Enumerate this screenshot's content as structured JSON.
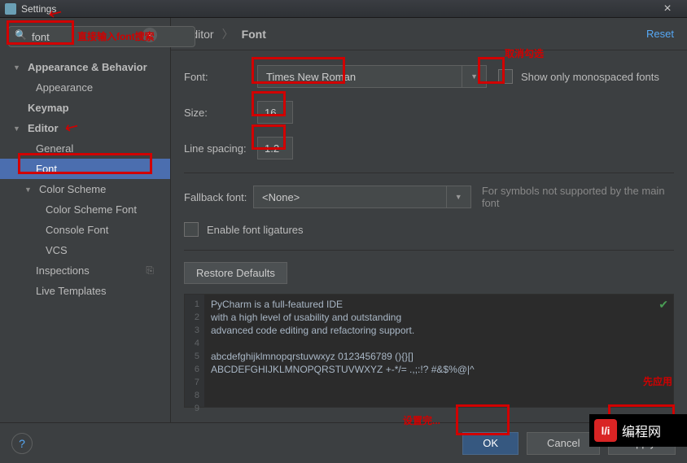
{
  "window": {
    "title": "Settings",
    "close": "×"
  },
  "search": {
    "value": "font",
    "glyph": "🔍",
    "clear": "×"
  },
  "tree": {
    "ab": "Appearance & Behavior",
    "appearance": "Appearance",
    "keymap": "Keymap",
    "editor": "Editor",
    "general": "General",
    "font": "Font",
    "cs": "Color Scheme",
    "csf": "Color Scheme Font",
    "cf": "Console Font",
    "vcs": "VCS",
    "insp": "Inspections",
    "lt": "Live Templates"
  },
  "crumb": {
    "editor": "Editor",
    "sep": "〉",
    "font": "Font",
    "reset": "Reset"
  },
  "form": {
    "font_label": "Font:",
    "font_value": "Times New Roman",
    "mono_label": "Show only monospaced fonts",
    "size_label": "Size:",
    "size_value": "16",
    "ls_label": "Line spacing:",
    "ls_value": "1.2",
    "fallback_label": "Fallback font:",
    "fallback_value": "<None>",
    "fallback_hint": "For symbols not supported by the main font",
    "lig_label": "Enable font ligatures",
    "restore": "Restore Defaults"
  },
  "preview": {
    "lines": [
      "1",
      "2",
      "3",
      "4",
      "5",
      "6",
      "7",
      "8",
      "9"
    ],
    "l1": "PyCharm is a full-featured IDE",
    "l2": "with a high level of usability and outstanding",
    "l3": "advanced code editing and refactoring support.",
    "l4": "",
    "l5": "abcdefghijklmnopqrstuvwxyz 0123456789 (){}[]",
    "l6": "ABCDEFGHIJKLMNOPQRSTUVWXYZ +-*/= .,;:!? #&$%@|^",
    "l7": "",
    "l8": "",
    "l9": ""
  },
  "footer": {
    "help": "?",
    "ok": "OK",
    "cancel": "Cancel",
    "apply": "Apply"
  },
  "ann": {
    "search_hint": "直接输入font搜索",
    "mono_hint": "取消勾选",
    "apply_hint": "先应用",
    "ok_hint": "设置完..."
  },
  "watermark": {
    "logo": "l/i",
    "text": "编程网"
  }
}
